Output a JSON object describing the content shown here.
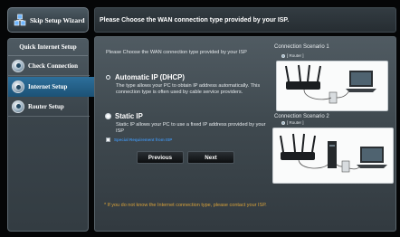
{
  "sidebar": {
    "skip_label": "Skip Setup Wizard",
    "section_title": "Quick Internet Setup",
    "items": [
      {
        "label": "Check Connection",
        "active": false
      },
      {
        "label": "Internet Setup",
        "active": true
      },
      {
        "label": "Router Setup",
        "active": false
      }
    ]
  },
  "header": {
    "title": "Please Choose the WAN connection type provided by your ISP."
  },
  "main": {
    "intro": "Please Choose the WAN connection type provided by your ISP",
    "options": [
      {
        "title": "Automatic IP (DHCP)",
        "description": "The type allows your PC to obtain IP address automatically. This connection type is often used by cable service providers.",
        "selected": false
      },
      {
        "title": "Static IP",
        "description": "Static IP allows your PC to use a fixed IP address provided by your ISP",
        "selected": true
      }
    ],
    "special_requirement": "Special Requirement from ISP",
    "previous_label": "Previous",
    "next_label": "Next",
    "footnote": "* If you do not know the Internet connection type, please contact your ISP."
  },
  "scenarios": [
    {
      "label": "Connection Scenario 1",
      "router_tag": "[ Router ]"
    },
    {
      "label": "Connection Scenario 2",
      "router_tag": "[ Router ]"
    }
  ],
  "colors": {
    "accent_blue": "#1c5276",
    "link_blue": "#3f8ee0",
    "footnote_orange": "#d9a23a"
  }
}
